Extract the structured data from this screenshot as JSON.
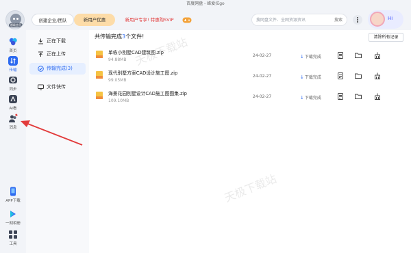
{
  "window": {
    "title": "百度网盘 - 峰爱拉go"
  },
  "header": {
    "avatar_badge": "超级会员",
    "enterprise_label": "创建企业/团队",
    "newuser_label": "新用户优惠",
    "promo_label": "新用户专享! 特惠购SVIP",
    "search_placeholder": "搜网盘文件、全网资源资讯",
    "search_button": "搜索",
    "hi_label": "Hi"
  },
  "leftnav": {
    "items": [
      {
        "label": "首页",
        "icon": "home-icon"
      },
      {
        "label": "传输",
        "icon": "transfer-icon"
      },
      {
        "label": "同步",
        "icon": "sync-icon"
      },
      {
        "label": "AI看",
        "icon": "ai-icon"
      },
      {
        "label": "消息",
        "icon": "message-icon"
      },
      {
        "label": "APP下载",
        "icon": "app-download-icon"
      },
      {
        "label": "一刻相册",
        "icon": "album-icon"
      },
      {
        "label": "工具",
        "icon": "tools-icon"
      }
    ]
  },
  "subnav": {
    "items": [
      {
        "label": "正在下载"
      },
      {
        "label": "正在上传"
      },
      {
        "label": "传输完成(3)"
      },
      {
        "label": "文件快传"
      }
    ]
  },
  "main": {
    "title_prefix": "共传输完成",
    "title_count": "3",
    "title_suffix": "个文件!",
    "clear_button": "清除所有记录",
    "files": [
      {
        "name": "单栋小别墅CAD建筑图.zip",
        "size": "94.88MB",
        "date": "24-02-27",
        "status": "下载完成"
      },
      {
        "name": "现代别墅方案CAD设计施工图.zip",
        "size": "99.05MB",
        "date": "24-02-27",
        "status": "下载完成"
      },
      {
        "name": "海景花园别墅设计CAD施工图图集.zip",
        "size": "109.10MB",
        "date": "24-02-27",
        "status": "下载完成"
      }
    ]
  },
  "watermark": "天极下载站",
  "colors": {
    "accent": "#2e6bf0",
    "annotation": "#e23b3b",
    "promo": "#e23b3b"
  }
}
